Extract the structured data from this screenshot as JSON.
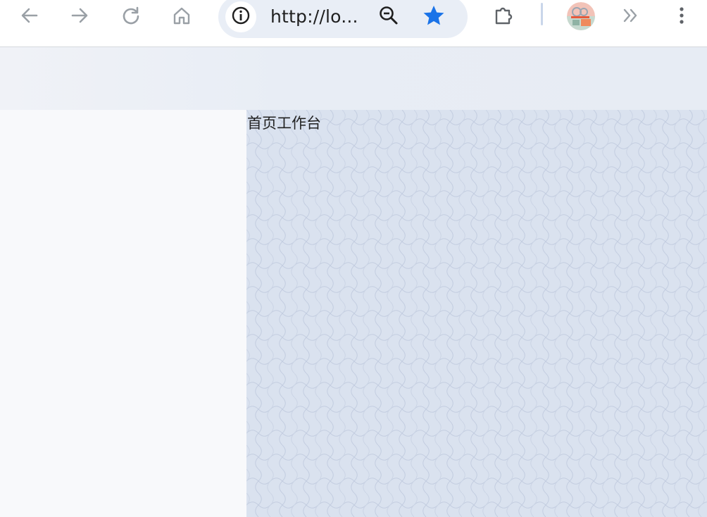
{
  "browser": {
    "url_display": "http://lo...",
    "icons": {
      "back": "arrow-left-icon",
      "forward": "arrow-right-icon",
      "reload": "reload-icon",
      "home": "home-icon",
      "site_info": "info-icon",
      "zoom": "zoom-out-icon",
      "bookmark": "star-icon",
      "extensions": "puzzle-icon",
      "more_tools": "chevron-double-right-icon",
      "menu": "kebab-menu-icon"
    },
    "colors": {
      "bookmark_star": "#1a73e8",
      "omnibox_bg": "#e9eef6"
    }
  },
  "page": {
    "content_title": "首页工作台",
    "colors": {
      "content_bg": "#dae2ef",
      "sidebar_bg": "#f8f9fb",
      "header_bg": "#e8edf5"
    }
  }
}
